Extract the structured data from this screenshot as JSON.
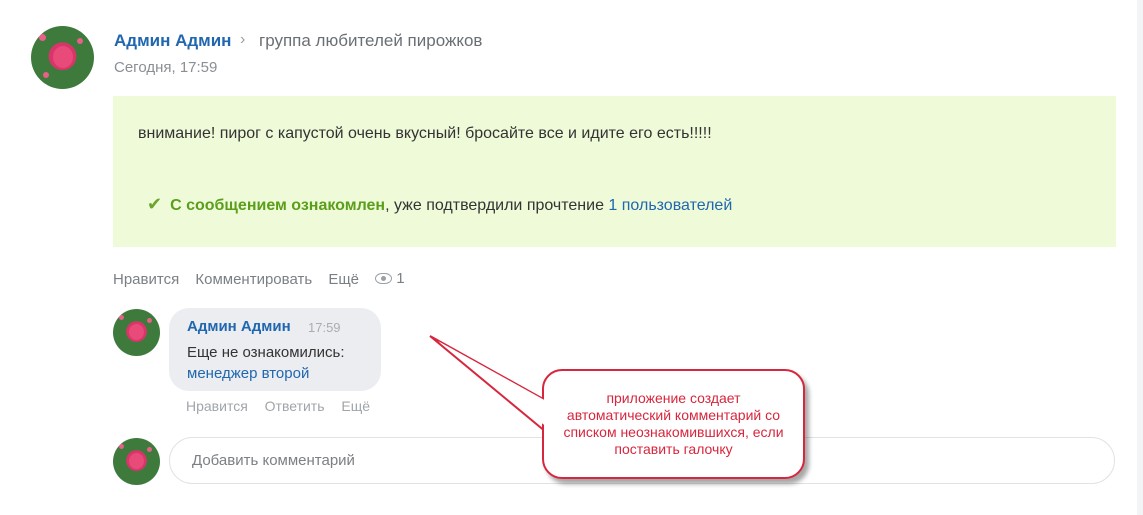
{
  "post": {
    "author": "Админ Админ",
    "group": "группа любителей пирожков",
    "time": "Сегодня, 17:59",
    "message": "внимание! пирог с капустой очень вкусный! бросайте все и идите его есть!!!!!",
    "ack": {
      "label": "С сообщением ознакомлен",
      "mid_text": ", уже подтвердили прочтение ",
      "users_link": "1 пользователей"
    },
    "actions": {
      "like": "Нравится",
      "comment": "Комментировать",
      "more": "Ещё",
      "views": "1"
    }
  },
  "comment": {
    "author": "Админ Админ",
    "time": "17:59",
    "text": "Еще не ознакомились:",
    "user_link": "менеджер второй",
    "actions": {
      "like": "Нравится",
      "reply": "Ответить",
      "more": "Ещё"
    }
  },
  "add_comment": {
    "placeholder": "Добавить комментарий"
  },
  "annotation": {
    "text": "приложение создает автоматический комментарий со списком неознакомившихся, если поставить галочку"
  },
  "colors": {
    "link": "#2067b0",
    "ack_green": "#5a9e1a",
    "message_bg": "#effad9",
    "annotation_red": "#d7263d"
  }
}
